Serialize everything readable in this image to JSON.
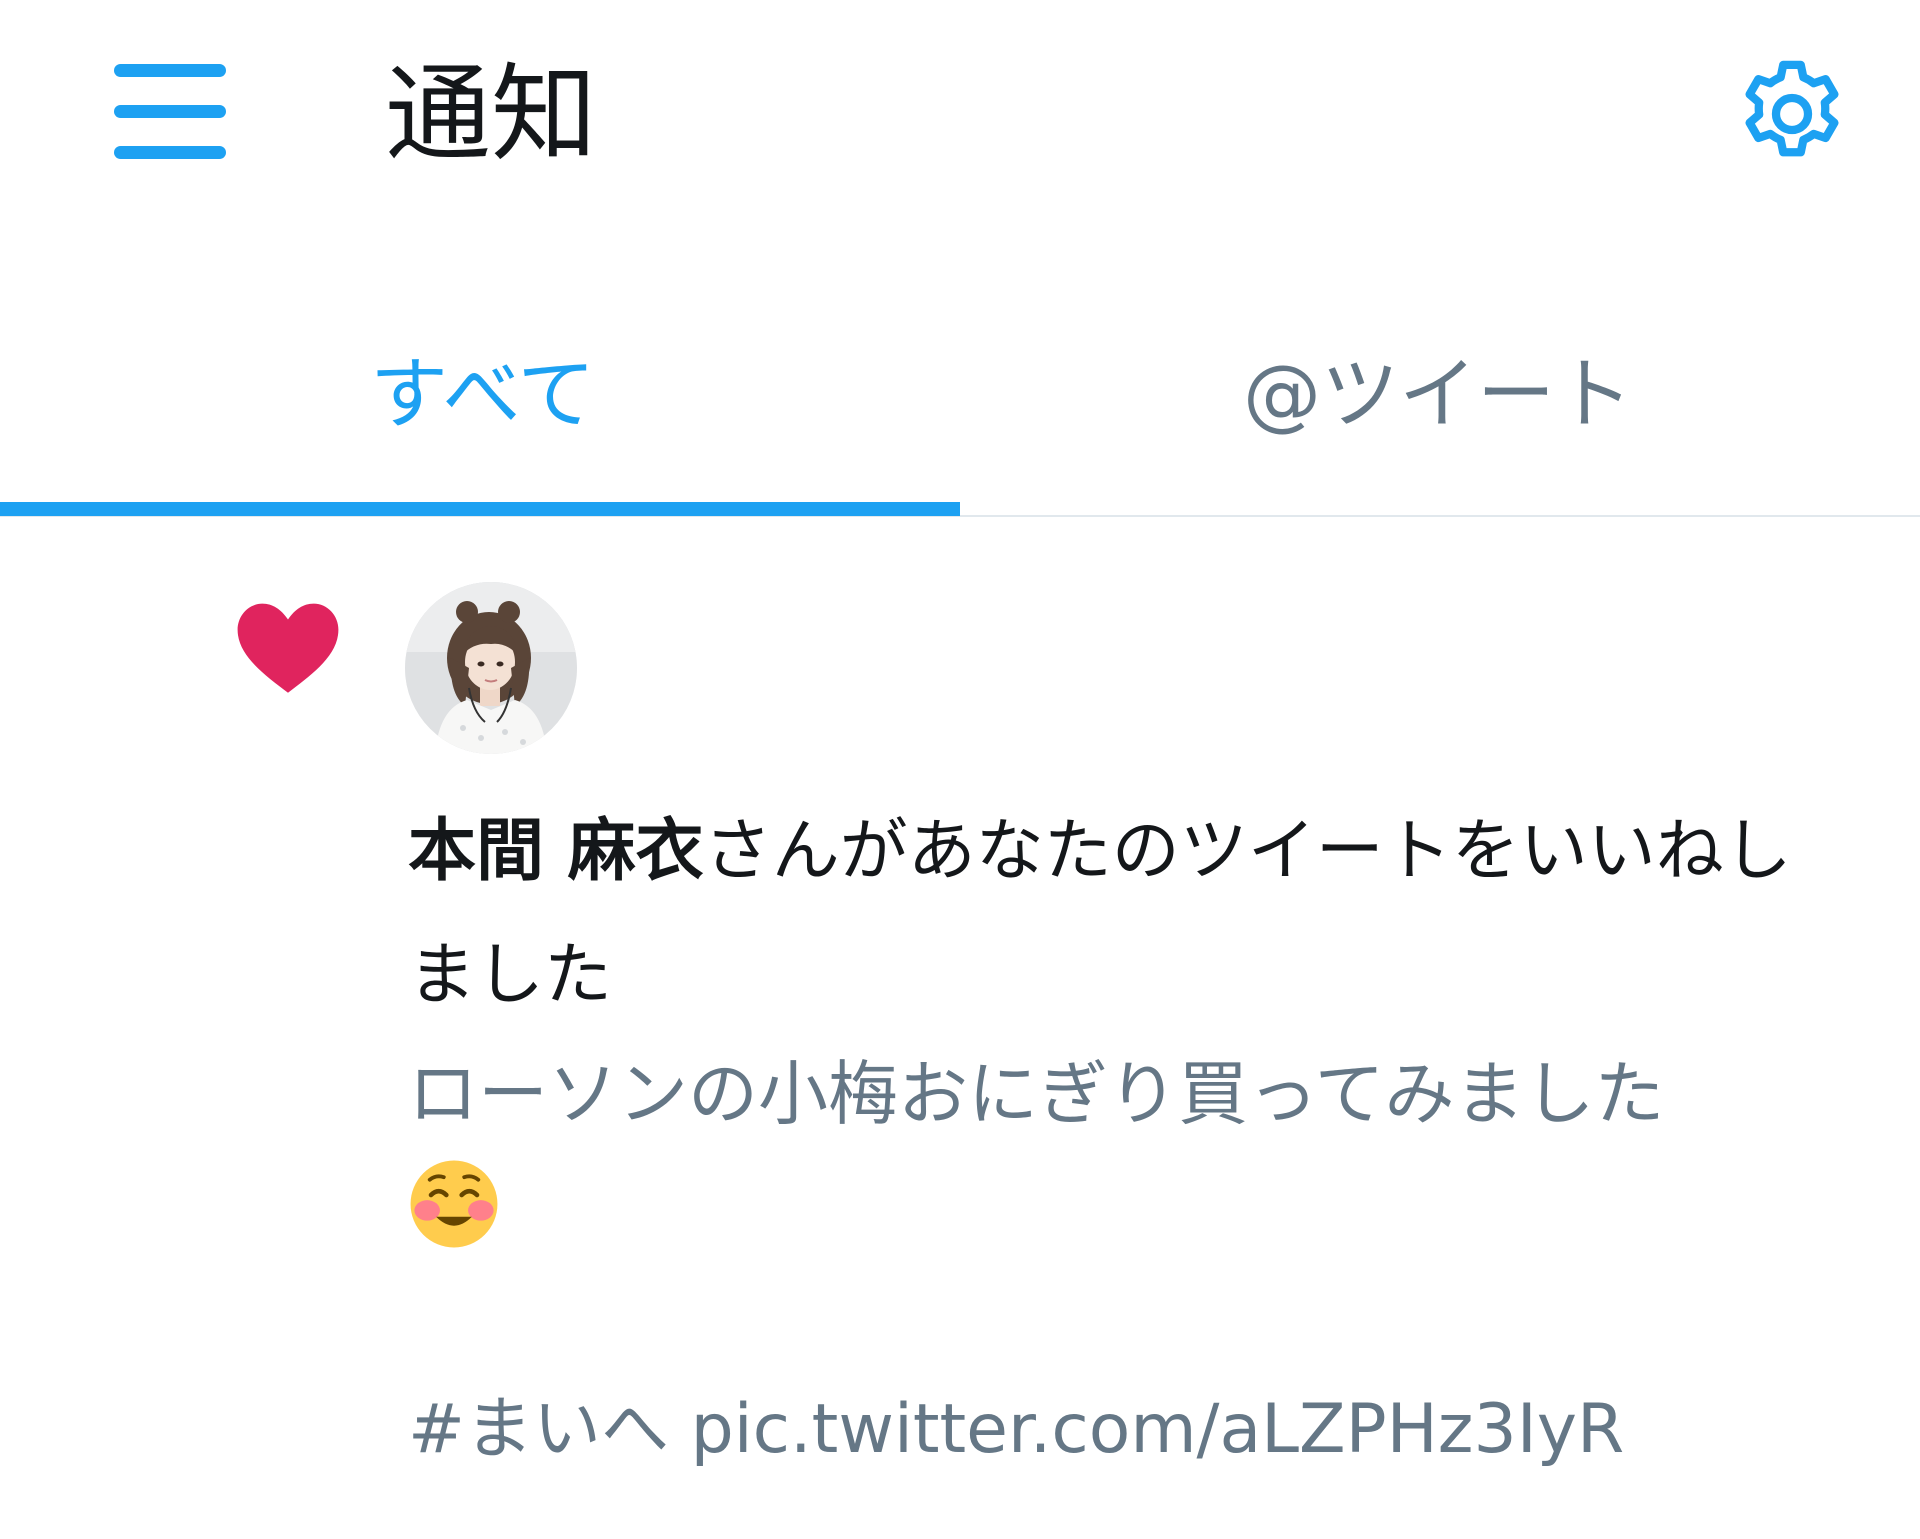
{
  "header": {
    "menu_icon": "hamburger-menu-icon",
    "title": "通知",
    "settings_icon": "gear-icon",
    "accent_color": "#1da1f2"
  },
  "tabs": [
    {
      "label": "すべて",
      "active": true
    },
    {
      "label": "@ツイート",
      "active": false
    }
  ],
  "notification": {
    "type_icon": "heart-icon",
    "type_color": "#e0245e",
    "avatar": "user-avatar",
    "user_name": "本間 麻衣",
    "action_text": "さんがあなたのツイートをいいねしました",
    "tweet_text": "ローソンの小梅おにぎり買ってみました",
    "tweet_emoji": "smiling-face-with-smiling-eyes-emoji",
    "hashtag": "#まいへ",
    "link": "pic.twitter.com/aLZPHz3IyR"
  }
}
